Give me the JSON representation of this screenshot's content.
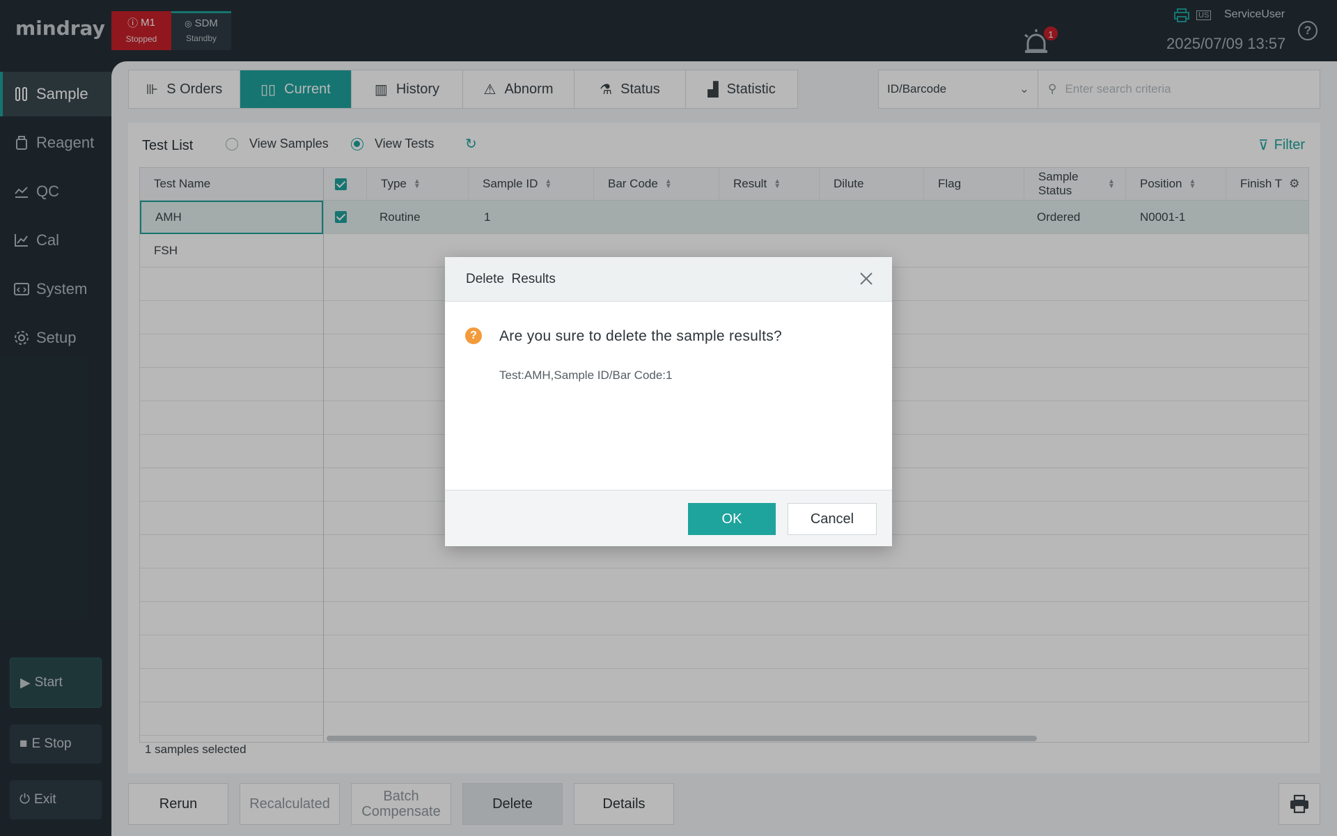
{
  "brand": "mindray",
  "modules": [
    {
      "name": "M1",
      "status": "Stopped",
      "color": "#c8202a"
    },
    {
      "name": "SDM",
      "status": "Standby",
      "color": "#1fa39d"
    }
  ],
  "header": {
    "alarm_count": "1",
    "lang": "US",
    "user": "ServiceUser",
    "datetime": "2025/07/09 13:57",
    "help": "?"
  },
  "nav": {
    "items": [
      {
        "label": "Sample",
        "icon": "tubes-icon"
      },
      {
        "label": "Reagent",
        "icon": "bottle-icon"
      },
      {
        "label": "QC",
        "icon": "qc-chart-icon"
      },
      {
        "label": "Cal",
        "icon": "line-chart-icon"
      },
      {
        "label": "System",
        "icon": "code-window-icon"
      },
      {
        "label": "Setup",
        "icon": "gear-icon"
      }
    ],
    "start": "Start",
    "estop": "E Stop",
    "exit": "Exit"
  },
  "tabs": [
    {
      "label": "S Orders",
      "icon": "add-tube-icon"
    },
    {
      "label": "Current",
      "icon": "tubes-icon"
    },
    {
      "label": "History",
      "icon": "history-icon"
    },
    {
      "label": "Abnorm",
      "icon": "warning-icon"
    },
    {
      "label": "Status",
      "icon": "status-icon"
    },
    {
      "label": "Statistic",
      "icon": "bar-chart-icon"
    }
  ],
  "search": {
    "field": "ID/Barcode",
    "placeholder": "Enter search criteria"
  },
  "list": {
    "title": "Test List",
    "view_samples": "View Samples",
    "view_tests": "View Tests",
    "filter": "Filter",
    "test_name_header": "Test Name",
    "test_names": [
      "AMH",
      "FSH"
    ],
    "columns": [
      "Type",
      "Sample ID",
      "Bar Code",
      "Result",
      "Dilute",
      "Flag",
      "Sample Status",
      "Position",
      "Finish T"
    ],
    "rows": [
      {
        "type": "Routine",
        "sample_id": "1",
        "bar_code": "",
        "result": "",
        "dilute": "",
        "flag": "",
        "sample_status": "Ordered",
        "position": "N0001-1",
        "finish": ""
      }
    ],
    "selected_count": "1 samples selected"
  },
  "bottom_buttons": {
    "rerun": "Rerun",
    "recalculated": "Recalculated",
    "batch_compensate": "Batch Compensate",
    "delete": "Delete",
    "details": "Details"
  },
  "dialog": {
    "title": "Delete  Results",
    "message": "Are you sure to delete the sample results?",
    "detail": "Test:AMH,Sample ID/Bar Code:1",
    "ok": "OK",
    "cancel": "Cancel"
  }
}
